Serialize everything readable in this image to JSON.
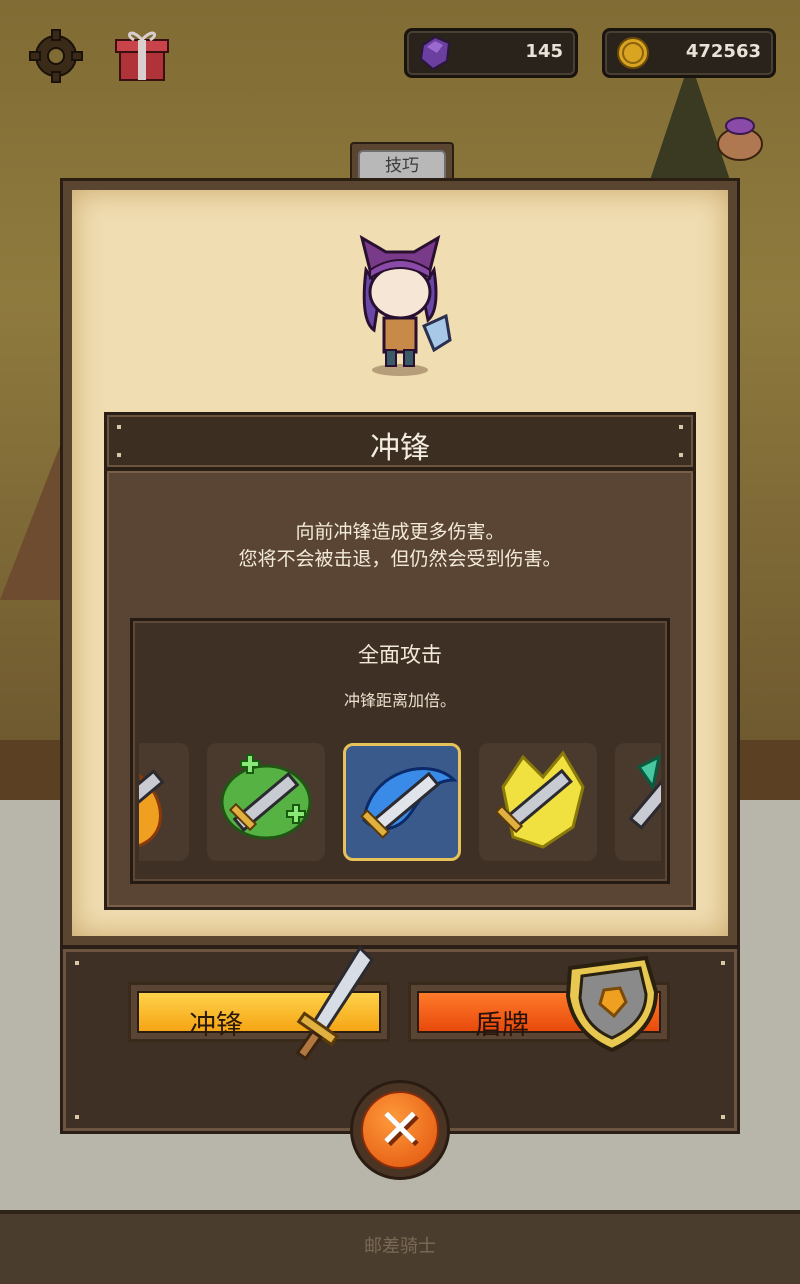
{
  "header": {
    "gem_count": "145",
    "gold_count": "472563",
    "settings_icon": "gear-icon",
    "gift_icon": "gift-icon"
  },
  "tab": {
    "label": "技巧"
  },
  "skill": {
    "name": "冲锋",
    "description_line1": "向前冲锋造成更多伤害。",
    "description_line2": "您将不会被击退，但仍然会受到伤害。"
  },
  "upgrade": {
    "name": "全面攻击",
    "description": "冲锋距离加倍。",
    "icons": [
      "fire-sword-icon",
      "heal-sword-icon",
      "ice-sword-icon",
      "lightning-sword-icon",
      "wind-sword-icon"
    ],
    "selected_index": 2
  },
  "buttons": {
    "charge_label": "冲锋",
    "shield_label": "盾牌",
    "close_icon": "close-icon"
  },
  "footer": {
    "label": "邮差骑士"
  },
  "colors": {
    "charge_button": "#f5a515",
    "shield_button": "#e84a0c",
    "selected_border": "#e6c25a"
  }
}
